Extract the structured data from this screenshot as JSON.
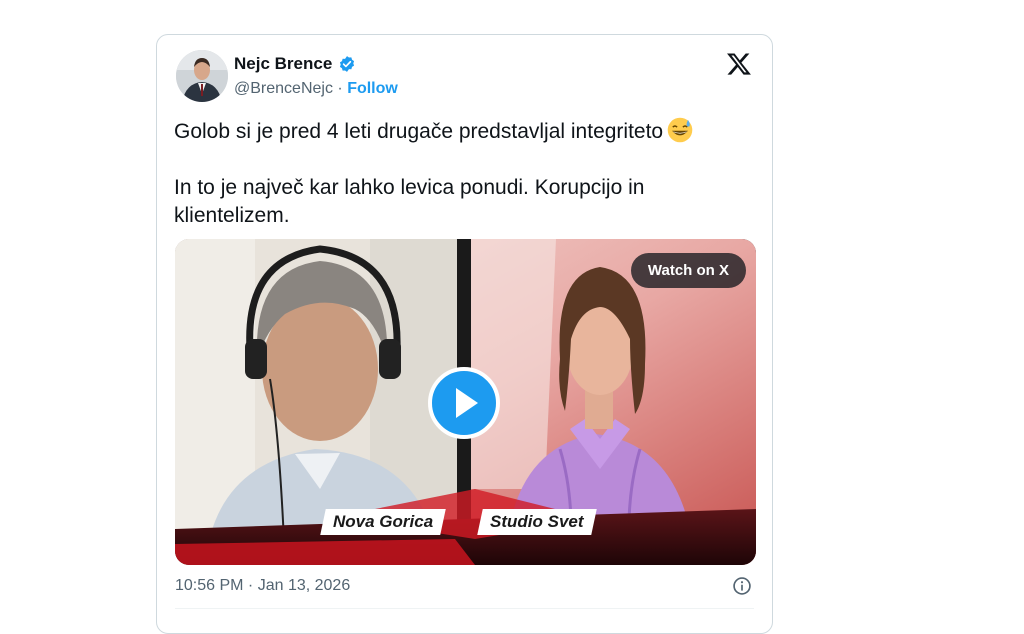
{
  "tweet": {
    "author_name": "Nejc Brence",
    "handle": "@BrenceNejc",
    "separator": "·",
    "follow_label": "Follow",
    "text_line1": "Golob si je pred 4 leti drugače predstavljal integriteto",
    "text_line2": "In to je največ kar lahko levica ponudi. Korupcijo in klientelizem.",
    "timestamp": "10:56 PM · Jan 13, 2026"
  },
  "media": {
    "watch_label": "Watch on X",
    "left_location": "Nova Gorica",
    "right_location": "Studio Svet"
  },
  "colors": {
    "accent": "#1d9bf0",
    "text_primary": "#0f1419",
    "text_secondary": "#536471",
    "border": "#cfd9de"
  },
  "icons": [
    "verified-badge-icon",
    "x-logo-icon",
    "grinning-sweat-emoji-icon",
    "play-icon",
    "info-icon"
  ]
}
